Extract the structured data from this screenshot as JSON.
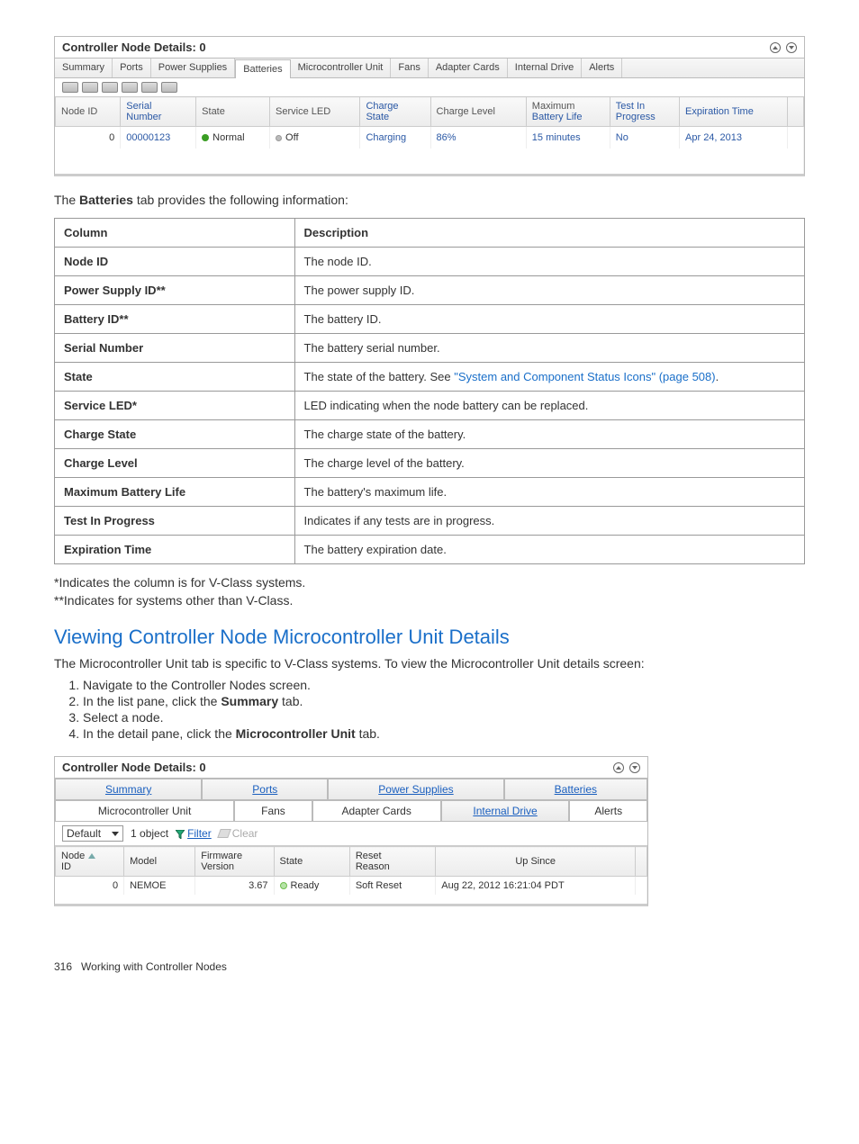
{
  "panel1": {
    "title": "Controller Node Details: 0",
    "tabs": [
      "Summary",
      "Ports",
      "Power Supplies",
      "Batteries",
      "Microcontroller Unit",
      "Fans",
      "Adapter Cards",
      "Internal Drive",
      "Alerts"
    ],
    "activeTab": "Batteries",
    "columns": {
      "c0": "Node ID",
      "c1a": "Serial",
      "c1b": "Number",
      "c2": "State",
      "c3": "Service LED",
      "c4a": "Charge",
      "c4b": "State",
      "c5": "Charge Level",
      "c6a": "Maximum",
      "c6b": "Battery Life",
      "c7a": "Test In",
      "c7b": "Progress",
      "c8": "Expiration Time"
    },
    "row": {
      "nodeId": "0",
      "serial": "00000123",
      "state": "Normal",
      "led": "Off",
      "chargeState": "Charging",
      "chargeLevel": "86%",
      "maxLife": "15 minutes",
      "testInProgress": "No",
      "expiration": "Apr 24, 2013"
    }
  },
  "intro": {
    "textA": "The ",
    "textB": "Batteries",
    "textC": " tab provides the following information:"
  },
  "descTable": {
    "hCol": "Column",
    "hDesc": "Description",
    "rows": [
      {
        "c": "Node ID",
        "d": "The node ID."
      },
      {
        "c": "Power Supply ID**",
        "d": "The power supply ID."
      },
      {
        "c": "Battery ID**",
        "d": "The battery ID."
      },
      {
        "c": "Serial Number",
        "d": "The battery serial number."
      },
      {
        "c": "State",
        "d": "The state of the battery. See ",
        "link": "\"System and Component Status Icons\" (page 508)",
        "tail": "."
      },
      {
        "c": "Service LED*",
        "d": "LED indicating when the node battery can be replaced."
      },
      {
        "c": "Charge State",
        "d": "The charge state of the battery."
      },
      {
        "c": "Charge Level",
        "d": "The charge level of the battery."
      },
      {
        "c": "Maximum Battery Life",
        "d": "The battery's maximum life."
      },
      {
        "c": "Test In Progress",
        "d": "Indicates if any tests are in progress."
      },
      {
        "c": "Expiration Time",
        "d": "The battery expiration date."
      }
    ]
  },
  "footnotes": {
    "a": "*Indicates the column is for V-Class systems.",
    "b": "**Indicates for systems other than V-Class."
  },
  "sectionHeading": "Viewing Controller Node Microcontroller Unit Details",
  "sectionIntro": "The Microcontroller Unit tab is specific to V-Class systems. To view the Microcontroller Unit details screen:",
  "steps": {
    "s1": "Navigate to the Controller Nodes screen.",
    "s2a": "In the list pane, click the ",
    "s2b": "Summary",
    "s2c": " tab.",
    "s3": "Select a node.",
    "s4a": "In the detail pane, click the ",
    "s4b": "Microcontroller Unit",
    "s4c": " tab."
  },
  "panel2": {
    "title": "Controller Node Details: 0",
    "tabsTop": [
      "Summary",
      "Ports",
      "Power Supplies",
      "Batteries"
    ],
    "tabsBottom": [
      "Microcontroller Unit",
      "Fans",
      "Adapter Cards",
      "Internal Drive",
      "Alerts"
    ],
    "activeTab": "Microcontroller Unit",
    "filter": {
      "default": "Default",
      "count": "1 object",
      "filter": "Filter",
      "clear": "Clear"
    },
    "cols": {
      "c0a": "Node",
      "c0b": "ID",
      "c1": "Model",
      "c2a": "Firmware",
      "c2b": "Version",
      "c3": "State",
      "c4a": "Reset",
      "c4b": "Reason",
      "c5": "Up Since"
    },
    "row": {
      "nodeId": "0",
      "model": "NEMOE",
      "fw": "3.67",
      "state": "Ready",
      "reason": "Soft Reset",
      "up": "Aug 22, 2012 16:21:04 PDT"
    }
  },
  "footer": {
    "page": "316",
    "label": "Working with Controller Nodes"
  }
}
